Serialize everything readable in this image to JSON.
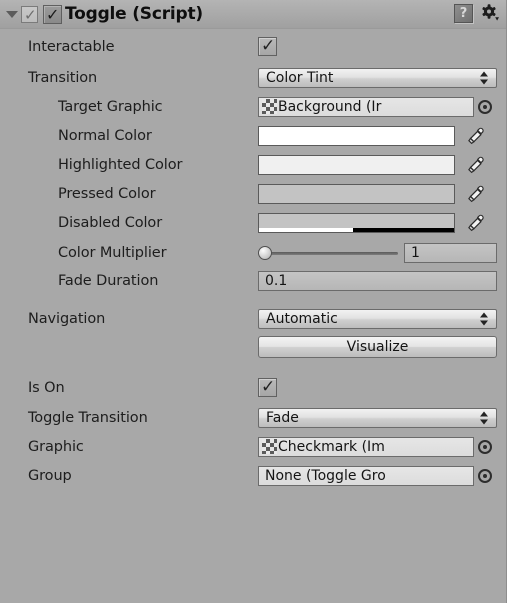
{
  "header": {
    "title": "Toggle (Script)",
    "enabled_checkbox": true,
    "script_icon_tick": "✓",
    "enable_tick": "✓",
    "help_icon": "help-icon",
    "gear_icon": "gear-icon"
  },
  "properties": {
    "interactable": {
      "label": "Interactable",
      "value": true,
      "tick": "✓"
    },
    "transition": {
      "label": "Transition",
      "value": "Color Tint"
    },
    "target_graphic": {
      "label": "Target Graphic",
      "value": "Background (Ir"
    },
    "normal_color": {
      "label": "Normal Color",
      "color": "#ffffff",
      "alpha_pct": 100
    },
    "highlighted_color": {
      "label": "Highlighted Color",
      "color": "#f0f0f0",
      "alpha_pct": 100
    },
    "pressed_color": {
      "label": "Pressed Color",
      "color": "#c3c3c3",
      "alpha_pct": 100
    },
    "disabled_color": {
      "label": "Disabled Color",
      "color": "#c3c3c3",
      "alpha_pct": 48
    },
    "color_multiplier": {
      "label": "Color Multiplier",
      "value": "1",
      "slider_pct": 0
    },
    "fade_duration": {
      "label": "Fade Duration",
      "value": "0.1"
    },
    "navigation": {
      "label": "Navigation",
      "value": "Automatic"
    },
    "visualize": {
      "label": "Visualize"
    },
    "is_on": {
      "label": "Is On",
      "value": true,
      "tick": "✓"
    },
    "toggle_transition": {
      "label": "Toggle Transition",
      "value": "Fade"
    },
    "graphic": {
      "label": "Graphic",
      "value": "Checkmark (Im"
    },
    "group": {
      "label": "Group",
      "value": "None (Toggle Gro"
    }
  },
  "theme": {
    "background": "#a8a8a8",
    "text": "#1d1d1d",
    "field_border": "#6b6b6b"
  }
}
